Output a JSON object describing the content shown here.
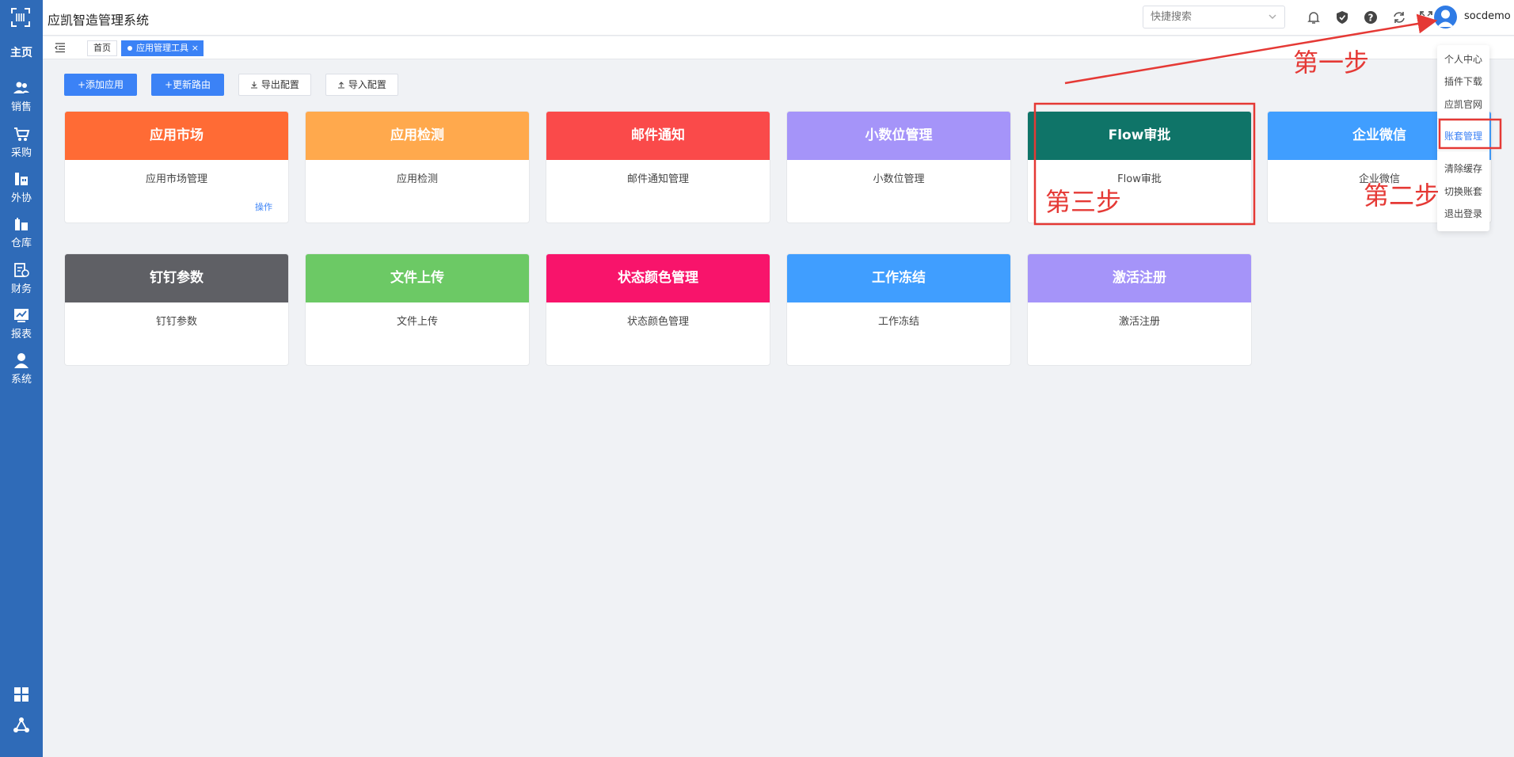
{
  "app": {
    "title": "应凯智造管理系统"
  },
  "header": {
    "search_placeholder": "快捷搜索",
    "icons": [
      "bell-icon",
      "shield-icon",
      "help-icon",
      "refresh-icon",
      "fullscreen-icon"
    ],
    "username": "socdemo"
  },
  "sidebar": {
    "home": "主页",
    "items": [
      {
        "label": "销售",
        "icon": "users-icon"
      },
      {
        "label": "采购",
        "icon": "cart-icon"
      },
      {
        "label": "外协",
        "icon": "factory-icon"
      },
      {
        "label": "仓库",
        "icon": "warehouse-icon"
      },
      {
        "label": "财务",
        "icon": "finance-icon"
      },
      {
        "label": "报表",
        "icon": "report-icon"
      },
      {
        "label": "系统",
        "icon": "person-icon"
      }
    ],
    "bottom_icons": [
      "grid-icon",
      "network-icon"
    ]
  },
  "tabs": {
    "home": "首页",
    "active": "应用管理工具",
    "close": "×"
  },
  "toolbar": {
    "add_app": "+添加应用",
    "update_route": "+更新路由",
    "export_config": "导出配置",
    "import_config": "导入配置"
  },
  "cards": [
    {
      "title": "应用市场",
      "desc": "应用市场管理",
      "color": "#ff6b35",
      "op": "操作"
    },
    {
      "title": "应用检测",
      "desc": "应用检测",
      "color": "#ffa94d"
    },
    {
      "title": "邮件通知",
      "desc": "邮件通知管理",
      "color": "#fa4a4a"
    },
    {
      "title": "小数位管理",
      "desc": "小数位管理",
      "color": "#a594f9"
    },
    {
      "title": "Flow审批",
      "desc": "Flow审批",
      "color": "#0f7468"
    },
    {
      "title": "企业微信",
      "desc": "企业微信",
      "color": "#409eff"
    },
    {
      "title": "钉钉参数",
      "desc": "钉钉参数",
      "color": "#5f6065"
    },
    {
      "title": "文件上传",
      "desc": "文件上传",
      "color": "#6cc965"
    },
    {
      "title": "状态颜色管理",
      "desc": "状态颜色管理",
      "color": "#f8146b"
    },
    {
      "title": "工作冻结",
      "desc": "工作冻结",
      "color": "#409eff"
    },
    {
      "title": "激活注册",
      "desc": "激活注册",
      "color": "#a594f9"
    }
  ],
  "dropdown": {
    "items": [
      "个人中心",
      "插件下载",
      "应凯官网",
      "账套管理",
      "清除缓存",
      "切换账套",
      "退出登录"
    ],
    "highlighted": "账套管理"
  },
  "annotations": {
    "step1": "第一步",
    "step2": "第二步",
    "step3": "第三步",
    "color": "#e53935"
  }
}
